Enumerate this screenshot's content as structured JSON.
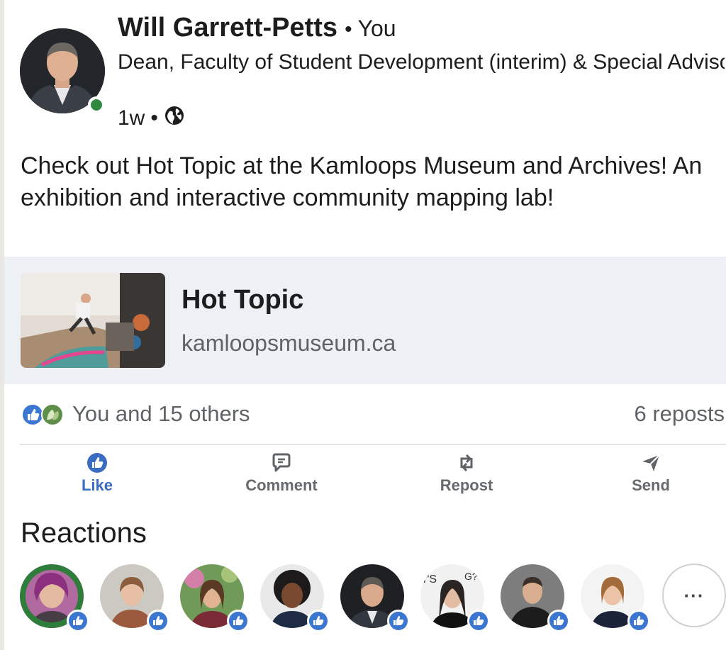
{
  "post": {
    "author_name": "Will Garrett-Petts",
    "separator": "•",
    "relationship": "You",
    "headline": "Dean, Faculty of Student Development (interim) & Special Advisor on Integrated Strategic Planning, Thom…",
    "time_ago": "1w",
    "meta_dot": "•",
    "visibility_icon": "globe-icon",
    "text": "Check out Hot Topic at the Kamloops Museum and Archives! An exhibition and interactive community mapping lab!"
  },
  "link_card": {
    "title": "Hot Topic",
    "domain": "kamloopsmuseum.ca"
  },
  "social": {
    "reactions_summary": "You and 15 others",
    "reposts": "6 reposts",
    "reaction_types": [
      "like-icon",
      "celebrate-icon"
    ]
  },
  "actions": [
    {
      "label": "Like",
      "icon": "like-icon",
      "active": true
    },
    {
      "label": "Comment",
      "icon": "comment-icon",
      "active": false
    },
    {
      "label": "Repost",
      "icon": "repost-icon",
      "active": false
    },
    {
      "label": "Send",
      "icon": "send-icon",
      "active": false
    }
  ],
  "reactions": {
    "heading": "Reactions",
    "more_label": "···",
    "reactor_count": 8
  },
  "colors": {
    "accent_blue": "#3a6dc1",
    "like_badge": "#3b77d1",
    "online_green": "#2f8a3f",
    "link_card_bg": "#edf1f6",
    "muted_text": "#5f6366"
  }
}
